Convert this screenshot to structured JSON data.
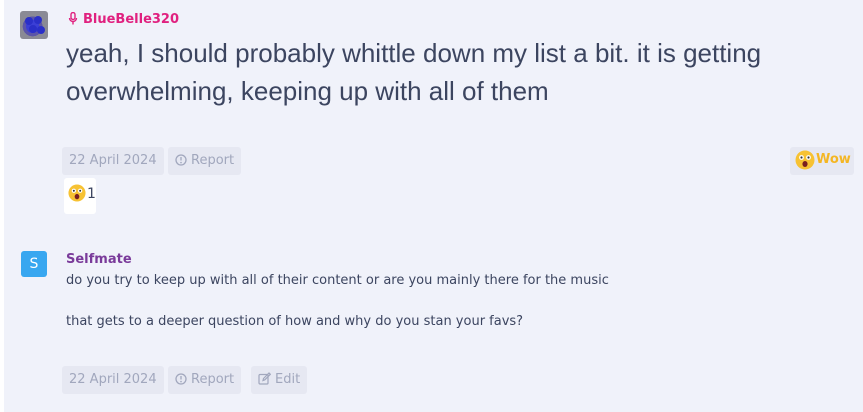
{
  "posts": [
    {
      "username": "BlueBelle320",
      "text": "yeah, I should probably whittle down my list a bit. it is getting overwhelming, keeping up with all of them",
      "date": "22 April 2024",
      "report_label": "Report",
      "wow_label": "Wow",
      "reaction_count": "1",
      "accent_color": "#e0217f"
    },
    {
      "avatar_letter": "S",
      "username": "Selfmate",
      "line1": "do you try to keep up with all of their content or are you mainly there for the music",
      "line2": "that gets to a deeper question of how and why do you stan your favs?",
      "date": "22 April 2024",
      "report_label": "Report",
      "edit_label": "Edit",
      "accent_color": "#7a3b9a"
    }
  ],
  "icons": {
    "mic": "microphone-icon",
    "report": "alert-circle-icon",
    "edit": "edit-icon",
    "wow": "wow-emoji-icon"
  }
}
